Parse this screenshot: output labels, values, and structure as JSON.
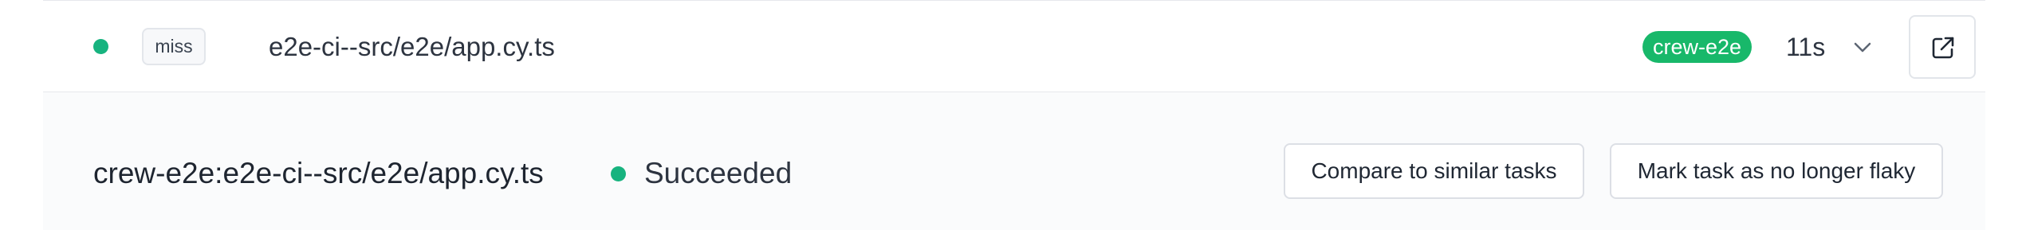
{
  "task_row": {
    "status": "success",
    "status_color": "#17b37f",
    "cache_label": "miss",
    "task_name": "e2e-ci--src/e2e/app.cy.ts",
    "project_badge": "crew-e2e",
    "project_badge_color": "#18b86a",
    "duration": "11s",
    "expand_icon": "chevron-down-icon",
    "open_icon": "external-link-icon"
  },
  "details": {
    "full_task_id": "crew-e2e:e2e-ci--src/e2e/app.cy.ts",
    "status_text": "Succeeded",
    "compare_button": "Compare to similar tasks",
    "flaky_button": "Mark task as no longer flaky"
  }
}
